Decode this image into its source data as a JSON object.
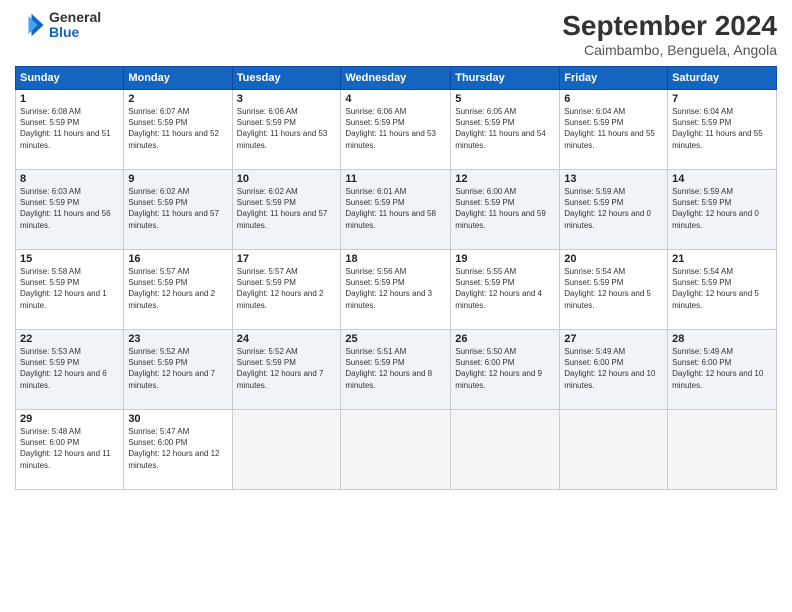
{
  "header": {
    "logo": {
      "line1": "General",
      "line2": "Blue"
    },
    "title": "September 2024",
    "subtitle": "Caimbambo, Benguela, Angola"
  },
  "weekdays": [
    "Sunday",
    "Monday",
    "Tuesday",
    "Wednesday",
    "Thursday",
    "Friday",
    "Saturday"
  ],
  "weeks": [
    [
      {
        "day": "1",
        "info": "Sunrise: 6:08 AM\nSunset: 5:59 PM\nDaylight: 11 hours and 51 minutes."
      },
      {
        "day": "2",
        "info": "Sunrise: 6:07 AM\nSunset: 5:59 PM\nDaylight: 11 hours and 52 minutes."
      },
      {
        "day": "3",
        "info": "Sunrise: 6:06 AM\nSunset: 5:59 PM\nDaylight: 11 hours and 53 minutes."
      },
      {
        "day": "4",
        "info": "Sunrise: 6:06 AM\nSunset: 5:59 PM\nDaylight: 11 hours and 53 minutes."
      },
      {
        "day": "5",
        "info": "Sunrise: 6:05 AM\nSunset: 5:59 PM\nDaylight: 11 hours and 54 minutes."
      },
      {
        "day": "6",
        "info": "Sunrise: 6:04 AM\nSunset: 5:59 PM\nDaylight: 11 hours and 55 minutes."
      },
      {
        "day": "7",
        "info": "Sunrise: 6:04 AM\nSunset: 5:59 PM\nDaylight: 11 hours and 55 minutes."
      }
    ],
    [
      {
        "day": "8",
        "info": "Sunrise: 6:03 AM\nSunset: 5:59 PM\nDaylight: 11 hours and 56 minutes."
      },
      {
        "day": "9",
        "info": "Sunrise: 6:02 AM\nSunset: 5:59 PM\nDaylight: 11 hours and 57 minutes."
      },
      {
        "day": "10",
        "info": "Sunrise: 6:02 AM\nSunset: 5:59 PM\nDaylight: 11 hours and 57 minutes."
      },
      {
        "day": "11",
        "info": "Sunrise: 6:01 AM\nSunset: 5:59 PM\nDaylight: 11 hours and 58 minutes."
      },
      {
        "day": "12",
        "info": "Sunrise: 6:00 AM\nSunset: 5:59 PM\nDaylight: 11 hours and 59 minutes."
      },
      {
        "day": "13",
        "info": "Sunrise: 5:59 AM\nSunset: 5:59 PM\nDaylight: 12 hours and 0 minutes."
      },
      {
        "day": "14",
        "info": "Sunrise: 5:59 AM\nSunset: 5:59 PM\nDaylight: 12 hours and 0 minutes."
      }
    ],
    [
      {
        "day": "15",
        "info": "Sunrise: 5:58 AM\nSunset: 5:59 PM\nDaylight: 12 hours and 1 minute."
      },
      {
        "day": "16",
        "info": "Sunrise: 5:57 AM\nSunset: 5:59 PM\nDaylight: 12 hours and 2 minutes."
      },
      {
        "day": "17",
        "info": "Sunrise: 5:57 AM\nSunset: 5:59 PM\nDaylight: 12 hours and 2 minutes."
      },
      {
        "day": "18",
        "info": "Sunrise: 5:56 AM\nSunset: 5:59 PM\nDaylight: 12 hours and 3 minutes."
      },
      {
        "day": "19",
        "info": "Sunrise: 5:55 AM\nSunset: 5:59 PM\nDaylight: 12 hours and 4 minutes."
      },
      {
        "day": "20",
        "info": "Sunrise: 5:54 AM\nSunset: 5:59 PM\nDaylight: 12 hours and 5 minutes."
      },
      {
        "day": "21",
        "info": "Sunrise: 5:54 AM\nSunset: 5:59 PM\nDaylight: 12 hours and 5 minutes."
      }
    ],
    [
      {
        "day": "22",
        "info": "Sunrise: 5:53 AM\nSunset: 5:59 PM\nDaylight: 12 hours and 6 minutes."
      },
      {
        "day": "23",
        "info": "Sunrise: 5:52 AM\nSunset: 5:59 PM\nDaylight: 12 hours and 7 minutes."
      },
      {
        "day": "24",
        "info": "Sunrise: 5:52 AM\nSunset: 5:59 PM\nDaylight: 12 hours and 7 minutes."
      },
      {
        "day": "25",
        "info": "Sunrise: 5:51 AM\nSunset: 5:59 PM\nDaylight: 12 hours and 8 minutes."
      },
      {
        "day": "26",
        "info": "Sunrise: 5:50 AM\nSunset: 6:00 PM\nDaylight: 12 hours and 9 minutes."
      },
      {
        "day": "27",
        "info": "Sunrise: 5:49 AM\nSunset: 6:00 PM\nDaylight: 12 hours and 10 minutes."
      },
      {
        "day": "28",
        "info": "Sunrise: 5:49 AM\nSunset: 6:00 PM\nDaylight: 12 hours and 10 minutes."
      }
    ],
    [
      {
        "day": "29",
        "info": "Sunrise: 5:48 AM\nSunset: 6:00 PM\nDaylight: 12 hours and 11 minutes."
      },
      {
        "day": "30",
        "info": "Sunrise: 5:47 AM\nSunset: 6:00 PM\nDaylight: 12 hours and 12 minutes."
      },
      null,
      null,
      null,
      null,
      null
    ]
  ]
}
